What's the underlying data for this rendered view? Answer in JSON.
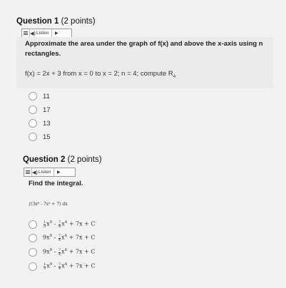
{
  "q1": {
    "title": "Question 1",
    "points": "(2 points)",
    "listen_label": "Listen",
    "prompt_line1": "Approximate the area under the graph of f(x) and above the x-axis using n",
    "prompt_line2": "rectangles.",
    "function_text": "f(x) = 2x + 3 from x = 0 to x = 2; n = 4; compute R",
    "function_subscript": "4",
    "options": [
      "11",
      "17",
      "13",
      "15"
    ]
  },
  "q2": {
    "title": "Question 2",
    "points": "(2 points)",
    "listen_label": "Listen",
    "prompt": "Find the integral.",
    "integral": "∫(3x⁸ - 7x³ + 7) dx",
    "options": [
      {
        "a": "1",
        "b": "3",
        "t1": "x",
        "e1": "9",
        "c": "7",
        "d": "4",
        "e2": "4",
        "rest": " + 7x + C",
        "lead": ""
      },
      {
        "a": "",
        "b": "",
        "t1": "9x",
        "e1": "9",
        "c": "7",
        "d": "4",
        "e2": "4",
        "rest": " + 7x + C",
        "lead": ""
      },
      {
        "a": "",
        "b": "",
        "t1": "9x",
        "e1": "9",
        "c": "7",
        "d": "4",
        "e2": "4",
        "rest": " + 7x + C",
        "lead": ""
      },
      {
        "a": "1",
        "b": "3",
        "t1": "x",
        "e1": "9",
        "c": "7",
        "d": "4",
        "e2": "4",
        "rest": " + 7x + C",
        "lead": ""
      }
    ]
  }
}
